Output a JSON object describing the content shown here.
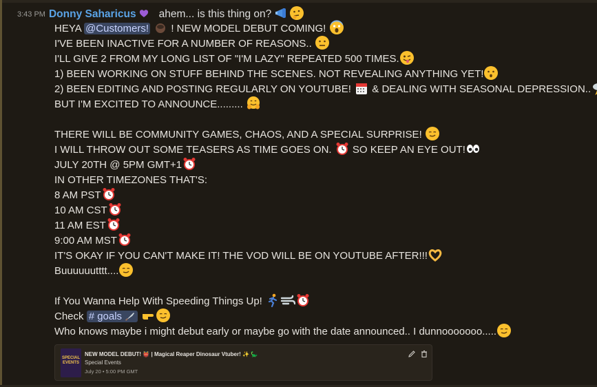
{
  "header": {
    "timestamp": "3:43 PM",
    "author": "Donny Saharicus",
    "status_text": "ahem... is this thing on?"
  },
  "message": {
    "l1": {
      "a": "HEYA ",
      "mention": "@Customers!",
      "b": " ! NEW MODEL DEBUT COMING!"
    },
    "l2": "I'VE BEEN INACTIVE FOR A NUMBER OF REASONS..",
    "l3": "I'LL GIVE 2 FROM MY LONG LIST OF \"I'M LAZY\" REPEATED 500 TIMES.",
    "l4": "1) BEEN WORKING ON STUFF BEHIND THE SCENES. NOT REVEALING ANYTHING YET!",
    "l5": {
      "a": "2) BEEN EDITING AND POSTING REGULARLY ON YOUTUBE! ",
      "b": " & DEALING WITH SEASONAL DEPRESSION.."
    },
    "l6": "BUT I'M EXCITED TO ANNOUNCE.........",
    "l8": "THERE WILL BE COMMUNITY GAMES, CHAOS, AND A SPECIAL SURPRISE!",
    "l9": {
      "a": "I WILL THROW OUT SOME TEASERS AS TIME GOES ON. ",
      "b": " SO KEEP AN EYE OUT!"
    },
    "l10": "JULY 20TH @ 5PM GMT+1",
    "l11": "IN OTHER TIMEZONES THAT'S:",
    "l12": "8 AM PST",
    "l13": "10 AM CST",
    "l14": "11 AM EST",
    "l15": "9:00 AM MST",
    "l16": "IT'S OKAY IF YOU CAN'T MAKE IT! THE VOD WILL BE ON YOUTUBE AFTER!!!",
    "l17": "Buuuuuutttt....",
    "l19": "If You Wanna Help With Speeding Things Up!",
    "l20": {
      "a": "Check ",
      "channel": "# goals"
    },
    "l21": "Who knows maybe i might debut early or maybe go with the date announced.. I dunnooooooo....."
  },
  "embed": {
    "thumbnail_text": "SPECIAL EVENTS",
    "title": "NEW MODEL DEBUT! 👹 | Magical Reaper Dinosaur Vtuber! ✨ 🦕",
    "subtitle": "Special Events",
    "date": "July 20 • 5:00 PM GMT",
    "edit_icon": "pencil-icon",
    "delete_icon": "trash-icon"
  },
  "colors": {
    "background": "#1e1a14",
    "author": "#5aa3e6",
    "mention_bg": "#3a4660",
    "mention_text": "#c9d4ff"
  },
  "icons": {
    "status": [
      "megaphone-icon",
      "thinking-face-icon"
    ],
    "heart": "purple-heart-icon",
    "reaction_emojis": [
      "scream-face-icon",
      "neutral-face-icon",
      "wink-tongue-face-icon",
      "hushed-face-icon",
      "calendar-icon",
      "storm-cloud-icon",
      "hugging-face-icon",
      "smirk-face-icon",
      "alarm-clock-icon",
      "eyes-icon",
      "heart-hands-icon",
      "running-man-icon",
      "dash-icon",
      "pointing-right-icon"
    ]
  }
}
